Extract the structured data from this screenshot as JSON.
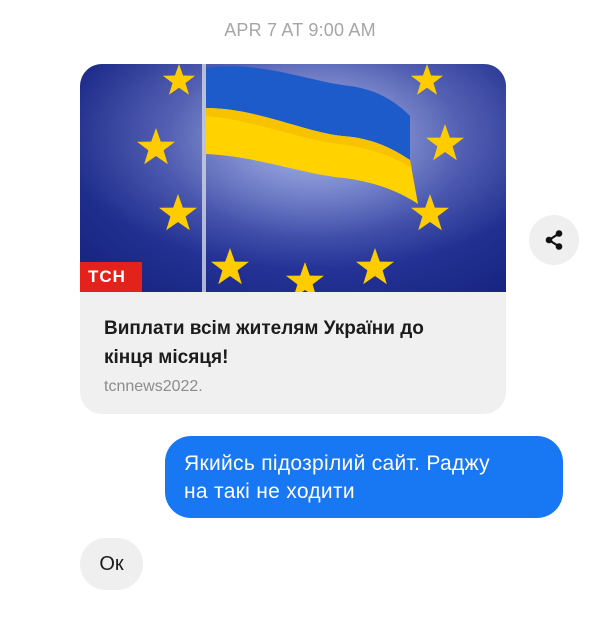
{
  "timestamp": "APR 7 AT 9:00 AM",
  "link_card": {
    "image_badge": "ТСН",
    "title_line1": "Виплати всім жителям України до",
    "title_line2": "кінця місяця!",
    "domain": "tcnnews2022."
  },
  "share_button": {
    "icon": "share-icon"
  },
  "messages": {
    "outgoing": {
      "line1": "Якийсь підозрілий сайт. Раджу",
      "line2": "на такі не ходити",
      "color": "#1877f2"
    },
    "incoming": {
      "text": "Ок"
    }
  },
  "colors": {
    "flag_blue": "#1c5bc9",
    "flag_yellow": "#ffd200",
    "eu_star": "#ffcc00",
    "badge_red": "#e3231b"
  }
}
